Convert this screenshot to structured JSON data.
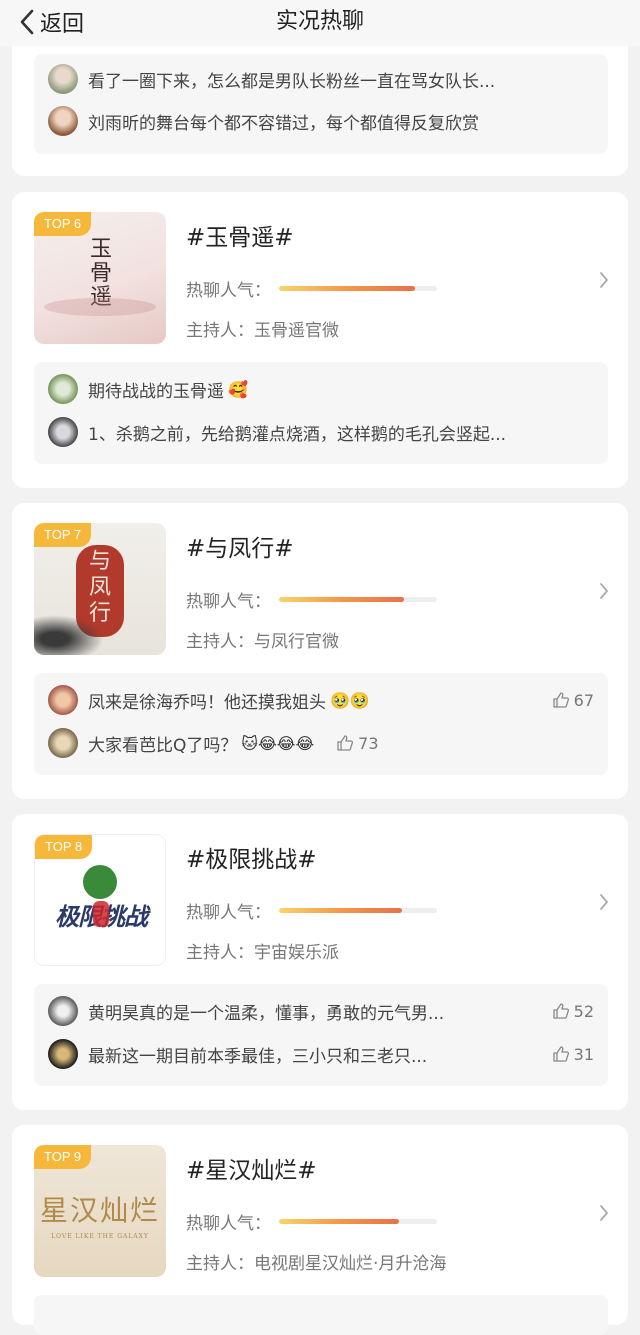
{
  "header": {
    "back_label": "返回",
    "title": "实况热聊"
  },
  "heat_label": "热聊人气：",
  "host_prefix": "主持人：",
  "top_card": {
    "comments": [
      {
        "text": "看了一圈下来，怎么都是男队长粉丝一直在骂女队长..."
      },
      {
        "text": "刘雨昕的舞台每个都不容错过，每个都值得反复欣赏"
      }
    ]
  },
  "cards": [
    {
      "rank": "TOP 6",
      "title": "#玉骨遥#",
      "heat": 0.86,
      "host": "玉骨遥官微",
      "thumb_text": "玉骨遥",
      "comments": [
        {
          "text": "期待战战的玉骨遥",
          "emoji": "🥰",
          "likes": ""
        },
        {
          "text": "1、杀鹅之前，先给鹅灌点烧酒，这样鹅的毛孔会竖起...",
          "emoji": "",
          "likes": ""
        }
      ]
    },
    {
      "rank": "TOP 7",
      "title": "#与凤行#",
      "heat": 0.79,
      "host": "与凤行官微",
      "thumb_text": "与凤行",
      "comments": [
        {
          "text": "凤来是徐海乔吗！他还摸我姐头",
          "emoji": "🥹🥹",
          "likes": "67"
        },
        {
          "text": "大家看芭比Q了吗？",
          "emoji": "🐱😂😂😂",
          "likes": "73"
        }
      ]
    },
    {
      "rank": "TOP 8",
      "title": "#极限挑战#",
      "heat": 0.78,
      "host": "宇宙娱乐派",
      "thumb_text": "极限挑战",
      "comments": [
        {
          "text": "黄明昊真的是一个温柔，懂事，勇敢的元气男...",
          "emoji": "",
          "likes": "52"
        },
        {
          "text": "最新这一期目前本季最佳，三小只和三老只...",
          "emoji": "",
          "likes": "31"
        }
      ]
    },
    {
      "rank": "TOP 9",
      "title": "#星汉灿烂#",
      "heat": 0.76,
      "host": "电视剧星汉灿烂·月升沧海",
      "thumb_text": "星汉灿烂",
      "thumb_sub": "LOVE LIKE THE GALAXY",
      "comments": []
    }
  ],
  "colors": {
    "accent": "#f6b83a",
    "bar_start": "#f9d36a",
    "bar_end": "#e9704b"
  }
}
